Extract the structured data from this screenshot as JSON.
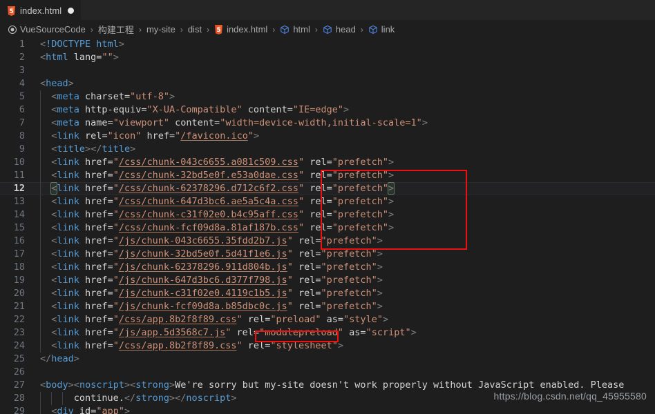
{
  "window": {
    "accent_red": "#ee1111",
    "background": "#1e1e1e"
  },
  "tab": {
    "label": "index.html",
    "icon": "html5-icon",
    "dirty": true
  },
  "breadcrumb": {
    "items": [
      {
        "label": "VueSourceCode",
        "icon": "circle-record-icon"
      },
      {
        "label": "构建工程",
        "icon": ""
      },
      {
        "label": "my-site",
        "icon": ""
      },
      {
        "label": "dist",
        "icon": ""
      },
      {
        "label": "index.html",
        "icon": "html5-icon"
      },
      {
        "label": "html",
        "icon": "cube-icon"
      },
      {
        "label": "head",
        "icon": "cube-icon"
      },
      {
        "label": "link",
        "icon": "cube-icon"
      }
    ],
    "separator": "›"
  },
  "editor": {
    "active_line": 12,
    "lines": [
      {
        "n": "1",
        "text": "<!DOCTYPE html>"
      },
      {
        "n": "2",
        "text": "<html lang=\"\">"
      },
      {
        "n": "3",
        "text": ""
      },
      {
        "n": "4",
        "text": "<head>"
      },
      {
        "n": "5",
        "text": "  <meta charset=\"utf-8\">"
      },
      {
        "n": "6",
        "text": "  <meta http-equiv=\"X-UA-Compatible\" content=\"IE=edge\">"
      },
      {
        "n": "7",
        "text": "  <meta name=\"viewport\" content=\"width=device-width,initial-scale=1\">"
      },
      {
        "n": "8",
        "text": "  <link rel=\"icon\" href=\"/favicon.ico\">"
      },
      {
        "n": "9",
        "text": "  <title></title>"
      },
      {
        "n": "10",
        "text": "  <link href=\"/css/chunk-043c6655.a081c509.css\" rel=\"prefetch\">"
      },
      {
        "n": "11",
        "text": "  <link href=\"/css/chunk-32bd5e0f.e53a0dae.css\" rel=\"prefetch\">"
      },
      {
        "n": "12",
        "text": "  <link href=\"/css/chunk-62378296.d712c6f2.css\" rel=\"prefetch\">"
      },
      {
        "n": "13",
        "text": "  <link href=\"/css/chunk-647d3bc6.ae5a5c4a.css\" rel=\"prefetch\">"
      },
      {
        "n": "14",
        "text": "  <link href=\"/css/chunk-c31f02e0.b4c95aff.css\" rel=\"prefetch\">"
      },
      {
        "n": "15",
        "text": "  <link href=\"/css/chunk-fcf09d8a.81af187b.css\" rel=\"prefetch\">"
      },
      {
        "n": "16",
        "text": "  <link href=\"/js/chunk-043c6655.35fdd2b7.js\" rel=\"prefetch\">"
      },
      {
        "n": "17",
        "text": "  <link href=\"/js/chunk-32bd5e0f.5d41f1e6.js\" rel=\"prefetch\">"
      },
      {
        "n": "18",
        "text": "  <link href=\"/js/chunk-62378296.911d804b.js\" rel=\"prefetch\">"
      },
      {
        "n": "19",
        "text": "  <link href=\"/js/chunk-647d3bc6.d377f798.js\" rel=\"prefetch\">"
      },
      {
        "n": "20",
        "text": "  <link href=\"/js/chunk-c31f02e0.4119c1b5.js\" rel=\"prefetch\">"
      },
      {
        "n": "21",
        "text": "  <link href=\"/js/chunk-fcf09d8a.b85dbc0c.js\" rel=\"prefetch\">"
      },
      {
        "n": "22",
        "text": "  <link href=\"/css/app.8b2f8f89.css\" rel=\"preload\" as=\"style\">"
      },
      {
        "n": "23",
        "text": "  <link href=\"/js/app.5d3568c7.js\" rel=\"modulepreload\" as=\"script\">"
      },
      {
        "n": "24",
        "text": "  <link href=\"/css/app.8b2f8f89.css\" rel=\"stylesheet\">"
      },
      {
        "n": "25",
        "text": "</head>"
      },
      {
        "n": "26",
        "text": ""
      },
      {
        "n": "27",
        "text": "<body><noscript><strong>We're sorry but my-site doesn't work properly without JavaScript enabled. Please"
      },
      {
        "n": "28",
        "text": "      continue.</strong></noscript>"
      },
      {
        "n": "29",
        "text": "  <div id=\"app\">"
      }
    ]
  },
  "annotations": {
    "box_prefetch_label": "rel=\"prefetch\" block highlight",
    "box_preload_label": "rel=\"preload\" highlight"
  },
  "watermark": {
    "text": "https://blog.csdn.net/qq_45955580"
  }
}
